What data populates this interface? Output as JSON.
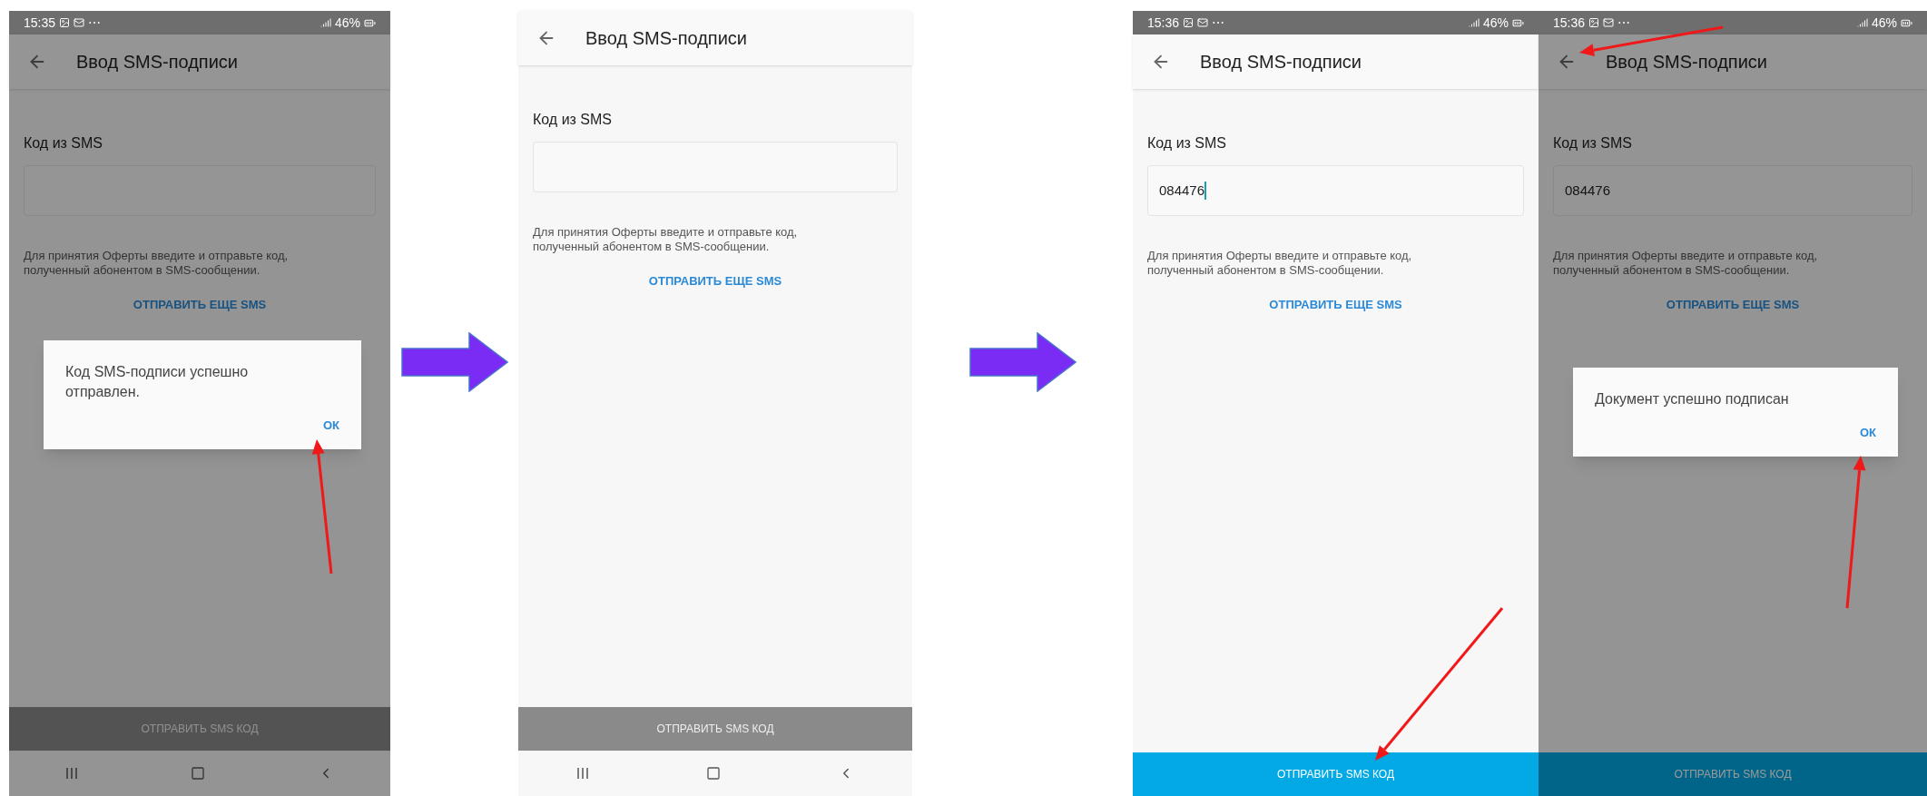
{
  "screens": [
    {
      "status_bar": {
        "time": "15:35",
        "more": "⋯",
        "battery": "46%"
      },
      "title": "Ввод SMS-подписи",
      "field_label": "Код из SMS",
      "focused": false,
      "hint": "Для принятия Оферты введите и отправьте код, полученный абонентом в SMS-сообщении.",
      "resend_link": "ОТПРАВИТЬ ЕЩЕ SMS",
      "submit_button": "ОТПРАВИТЬ SMS КОД",
      "submit_enabled": false,
      "nav_bar": true,
      "dimmed": true,
      "dialog": {
        "message": "Код SMS-подписи успешно отправлен.",
        "button": "ОК"
      }
    },
    {
      "title": "Ввод SMS-подписи",
      "field_label": "Код из SMS",
      "focused": false,
      "hint": "Для принятия Оферты введите и отправьте код, полученный абонентом в SMS-сообщении.",
      "resend_link": "ОТПРАВИТЬ ЕЩЕ SMS",
      "submit_button": "ОТПРАВИТЬ SMS КОД",
      "submit_enabled": false,
      "nav_bar": true,
      "dimmed": false
    },
    {
      "status_bar": {
        "time": "15:36",
        "more": "⋯",
        "battery": "46%"
      },
      "title": "Ввод SMS-подписи",
      "field_label": "Код из SMS",
      "field_value": "084476",
      "focused": true,
      "hint": "Для принятия Оферты введите и отправьте код, полученный абонентом в SMS-сообщении.",
      "resend_link": "ОТПРАВИТЬ ЕЩЕ SMS",
      "submit_button": "ОТПРАВИТЬ SMS КОД",
      "submit_enabled": true,
      "nav_bar": false,
      "dimmed": false
    },
    {
      "status_bar": {
        "time": "15:36",
        "more": "⋯",
        "battery": "46%"
      },
      "title": "Ввод SMS-подписи",
      "field_label": "Код из SMS",
      "field_value": "084476",
      "focused": false,
      "hint": "Для принятия Оферты введите и отправьте код, полученный абонентом в SMS-сообщении.",
      "resend_link": "ОТПРАВИТЬ ЕЩЕ SMS",
      "submit_button": "ОТПРАВИТЬ SMS КОД",
      "submit_enabled": true,
      "nav_bar": false,
      "dimmed": true,
      "dialog": {
        "message": "Документ успешно подписан",
        "button": "ОК"
      }
    }
  ]
}
